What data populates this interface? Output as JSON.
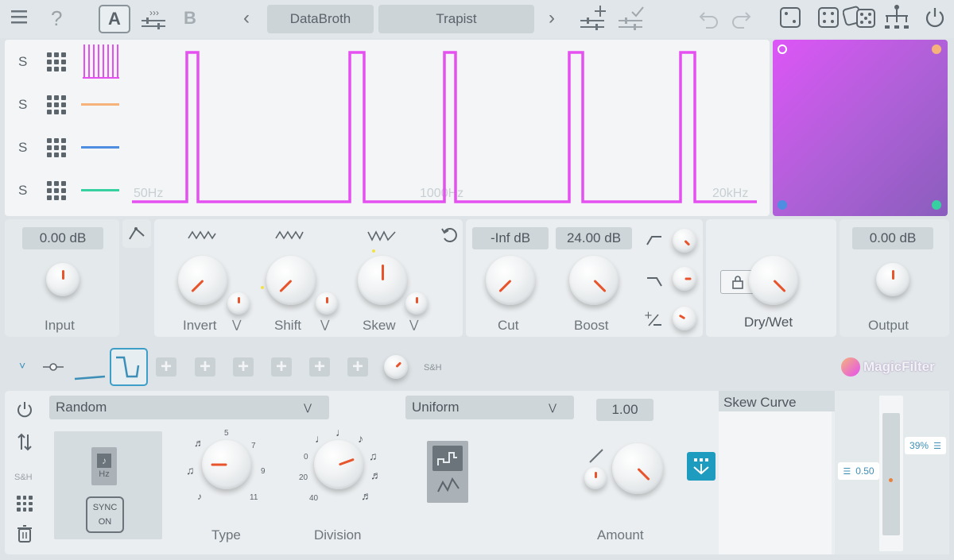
{
  "toolbar": {
    "menu_icon": "menu-icon",
    "help": "?",
    "a_label": "A",
    "b_label": "B",
    "prev": "‹",
    "next": "›",
    "preset_bank": "DataBroth",
    "preset_name": "Trapist"
  },
  "graph": {
    "rows": [
      "S",
      "S",
      "S",
      "S"
    ],
    "colors": {
      "pink": "#e550f0",
      "orange": "#f5b27a",
      "blue": "#4f8de0",
      "green": "#37d0a0"
    },
    "freq_labels": [
      "50Hz",
      "1000Hz",
      "20kHz"
    ]
  },
  "input": {
    "value": "0.00 dB",
    "label": "Input"
  },
  "modifiers": {
    "invert": "Invert",
    "shift": "Shift",
    "skew": "Skew"
  },
  "cutboost": {
    "cut_value": "-Inf dB",
    "boost_value": "24.00 dB",
    "cut": "Cut",
    "boost": "Boost"
  },
  "drywet": {
    "label": "Dry/Wet"
  },
  "output": {
    "value": "0.00 dB",
    "label": "Output"
  },
  "modbar": {
    "chevron": "˅",
    "sh_label": "S&H",
    "brand": "MagicFilter"
  },
  "modulator": {
    "source": "Random",
    "distribution": "Uniform",
    "amount_value": "1.00",
    "skew_curve": "Skew Curve",
    "sh_side": "S&H",
    "hz": "Hz",
    "sync": "SYNC",
    "sync_state": "ON",
    "type_label": "Type",
    "division_label": "Division",
    "amount_label": "Amount",
    "slider_left": "0.50",
    "slider_right": "39%",
    "type_ticks": [
      "5",
      "7",
      "9",
      "11"
    ],
    "division_ticks": [
      "0",
      "20",
      "40"
    ]
  }
}
